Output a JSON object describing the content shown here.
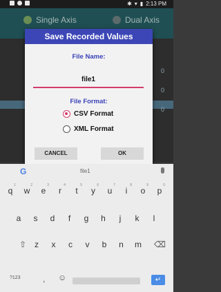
{
  "status_bar": {
    "time": "2:13 PM"
  },
  "app": {
    "mode_options": [
      {
        "label": "Single Axis"
      },
      {
        "label": "Dual Axis"
      }
    ],
    "bg_row_labels": [
      "0",
      "0",
      "0"
    ]
  },
  "dialog": {
    "title": "Save Recorded Values",
    "file_name_label": "File Name:",
    "file_name_value": "file1",
    "file_format_label": "File Format:",
    "formats": [
      {
        "label": "CSV Format",
        "selected": true
      },
      {
        "label": "XML Format",
        "selected": false
      }
    ],
    "cancel_label": "CANCEL",
    "ok_label": "OK"
  },
  "keyboard": {
    "suggestion": "file1",
    "row1": [
      {
        "key": "q",
        "hint": "1"
      },
      {
        "key": "w",
        "hint": "2"
      },
      {
        "key": "e",
        "hint": "3"
      },
      {
        "key": "r",
        "hint": "4"
      },
      {
        "key": "t",
        "hint": "5"
      },
      {
        "key": "y",
        "hint": "6"
      },
      {
        "key": "u",
        "hint": "7"
      },
      {
        "key": "i",
        "hint": "8"
      },
      {
        "key": "o",
        "hint": "9"
      },
      {
        "key": "p",
        "hint": "0"
      }
    ],
    "row2": [
      "a",
      "s",
      "d",
      "f",
      "g",
      "h",
      "j",
      "k",
      "l"
    ],
    "row3": [
      "z",
      "x",
      "c",
      "v",
      "b",
      "n",
      "m"
    ],
    "symbols_label": "?123",
    "comma_label": ",",
    "emoji_icon": "emoji-icon",
    "enter_icon": "enter-icon",
    "shift_icon": "shift-icon",
    "backspace_icon": "backspace-icon"
  }
}
